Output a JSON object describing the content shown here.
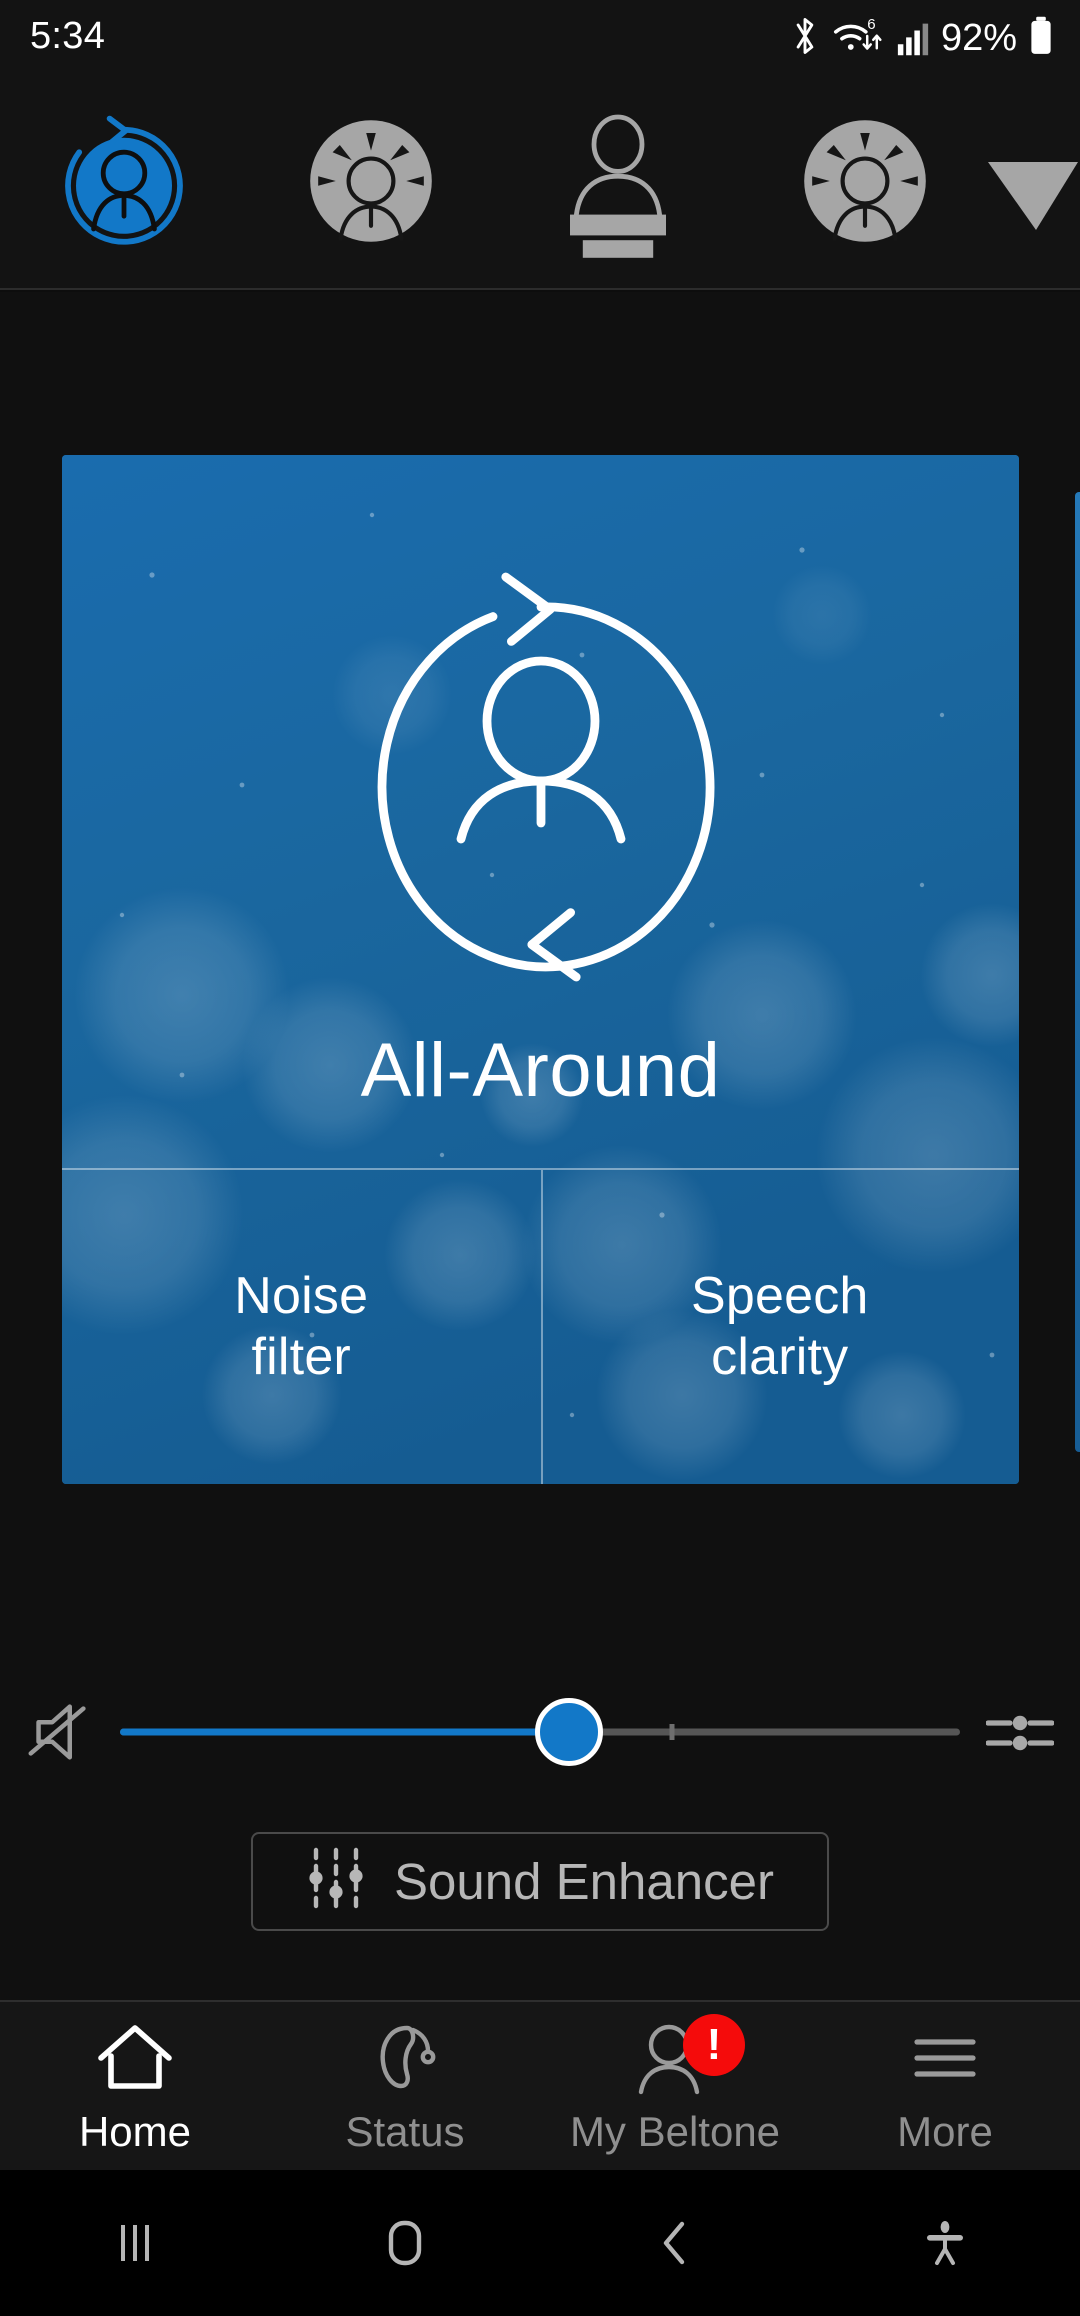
{
  "status_bar": {
    "clock": "5:34",
    "battery_percent": "92%",
    "icons": [
      "bluetooth-icon",
      "wifi-6-icon",
      "cellular-signal-icon",
      "battery-icon"
    ]
  },
  "program_selector": {
    "programs": [
      {
        "name": "All-Around",
        "icon": "all-around-icon",
        "selected": true
      },
      {
        "name": "Restaurant",
        "icon": "restaurant-icon",
        "selected": false
      },
      {
        "name": "Lecture",
        "icon": "lecture-podium-icon",
        "selected": false
      },
      {
        "name": "Restaurant",
        "icon": "restaurant-icon",
        "selected": false
      }
    ],
    "more_indicator": "chevron-right-icon",
    "accent_color": "#1278c8",
    "inactive_color": "#9e9e9e"
  },
  "drag_handle": "drag-handle",
  "program_card": {
    "title": "All-Around",
    "icon": "all-around-icon",
    "left_feature": "Noise\nfilter",
    "left_feature_line1": "Noise",
    "left_feature_line2": "filter",
    "right_feature_line1": "Speech",
    "right_feature_line2": "clarity",
    "background_color": "#1a68a8"
  },
  "volume": {
    "mute_icon": "mute-speaker-icon",
    "balance_icon": "balance-icon",
    "level_percent": 54,
    "fill_color": "#1278c8",
    "track_color": "#565656"
  },
  "sound_enhancer": {
    "label": "Sound Enhancer",
    "icon": "equalizer-icon"
  },
  "bottom_nav": {
    "items": [
      {
        "label": "Home",
        "icon": "home-icon",
        "active": true,
        "badge": null
      },
      {
        "label": "Status",
        "icon": "hearing-aid-icon",
        "active": false,
        "badge": null
      },
      {
        "label": "My Beltone",
        "icon": "person-icon",
        "active": false,
        "badge": "!"
      },
      {
        "label": "More",
        "icon": "hamburger-icon",
        "active": false,
        "badge": null
      }
    ],
    "badge_color": "#f50b0b"
  },
  "android_nav": {
    "items": [
      "recent-apps-icon",
      "home-button-icon",
      "back-icon",
      "accessibility-icon"
    ]
  }
}
